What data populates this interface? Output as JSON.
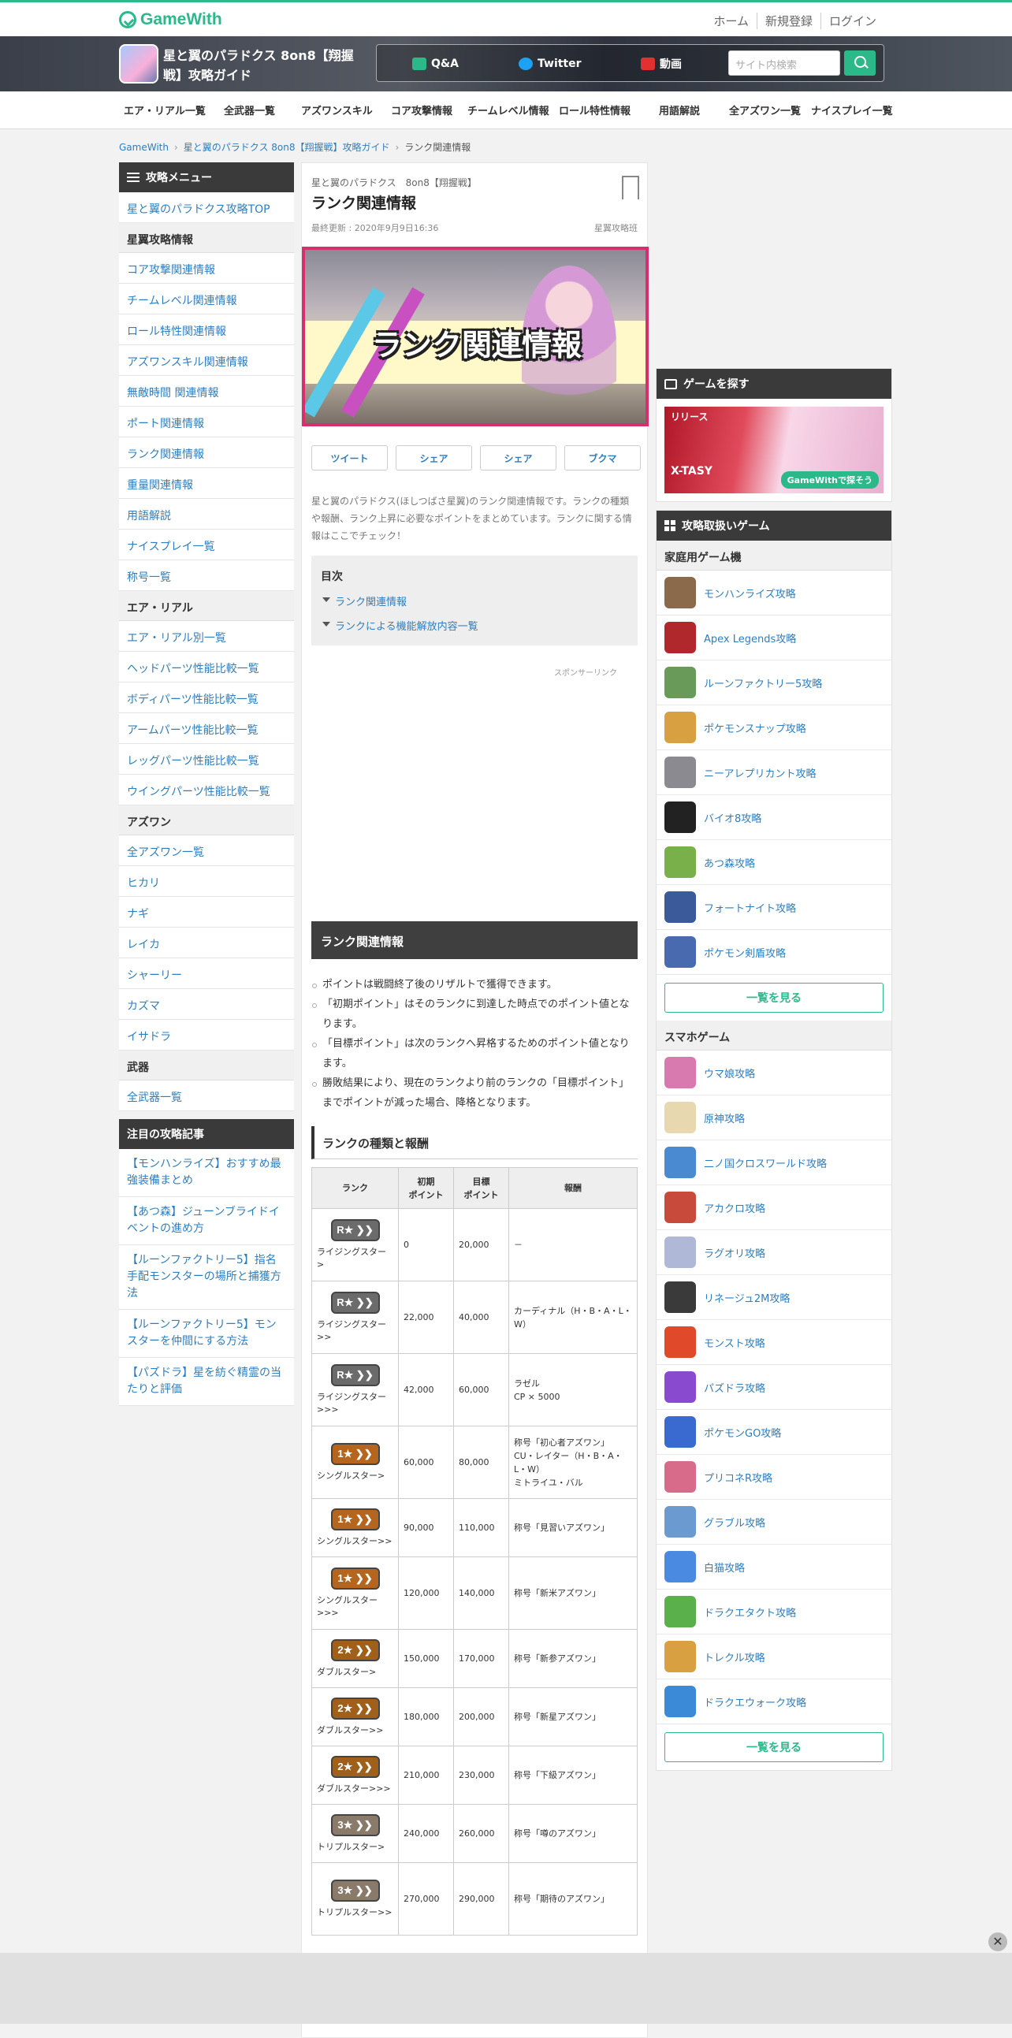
{
  "header": {
    "logo": "GameWith",
    "links": [
      "ホーム",
      "新規登録",
      "ログイン"
    ]
  },
  "gamebar": {
    "title": "星と翼のパラドクス 8on8【翔握戦】攻略ガイド",
    "buttons": [
      "Q&A",
      "Twitter",
      "動画"
    ],
    "search_placeholder": "サイト内検索"
  },
  "nav": [
    "エア・リアル一覧",
    "全武器一覧",
    "アズワンスキル",
    "コア攻撃情報",
    "チームレベル情報",
    "ロール特性情報",
    "用語解説",
    "全アズワン一覧",
    "ナイスプレイ一覧"
  ],
  "breadcrumb": [
    "GameWith",
    "星と翼のパラドクス 8on8【翔握戦】攻略ガイド",
    "ランク関連情報"
  ],
  "left_menu": {
    "title": "攻略メニュー",
    "top_link": "星と翼のパラドクス攻略TOP",
    "sections": [
      {
        "name": "星翼攻略情報",
        "items": [
          "コア攻撃関連情報",
          "チームレベル関連情報",
          "ロール特性関連情報",
          "アズワンスキル関連情報",
          "無敵時間 関連情報",
          "ポート関連情報",
          "ランク関連情報",
          "重量関連情報",
          "用語解説",
          "ナイスプレイ一覧",
          "称号一覧"
        ]
      },
      {
        "name": "エア・リアル",
        "items": [
          "エア・リアル別一覧",
          "ヘッドパーツ性能比較一覧",
          "ボディパーツ性能比較一覧",
          "アームパーツ性能比較一覧",
          "レッグパーツ性能比較一覧",
          "ウイングパーツ性能比較一覧"
        ]
      },
      {
        "name": "アズワン",
        "items": [
          "全アズワン一覧",
          "ヒカリ",
          "ナギ",
          "レイカ",
          "シャーリー",
          "カズマ",
          "イサドラ"
        ]
      },
      {
        "name": "武器",
        "items": [
          "全武器一覧"
        ]
      }
    ]
  },
  "notice": {
    "title": "注目の攻略記事",
    "items": [
      "【モンハンライズ】おすすめ最強装備まとめ",
      "【あつ森】ジューンブライドイベントの進め方",
      "【ルーンファクトリー5】指名手配モンスターの場所と捕獲方法",
      "【ルーンファクトリー5】モンスターを仲間にする方法",
      "【パズドラ】星を紡ぐ精霊の当たりと評価"
    ]
  },
  "article": {
    "subtitle": "星と翼のパラドクス　8on8【翔握戦】",
    "title": "ランク関連情報",
    "updated": "最終更新 : 2020年9月9日16:36",
    "author": "星翼攻略班",
    "banner_text": "ランク関連情報",
    "share": [
      "ツイート",
      "シェア",
      "シェア",
      "ブクマ"
    ],
    "intro": "星と翼のパラドクス(ほしつばさ星翼)のランク関連情報です。ランクの種類や報酬、ランク上昇に必要なポイントをまとめています。ランクに関する情報はここでチェック！",
    "toc_title": "目次",
    "toc": [
      "ランク関連情報",
      "ランクによる機能解放内容一覧"
    ],
    "sponsor": "スポンサーリンク",
    "section_title": "ランク関連情報",
    "bullets": [
      "ポイントは戦闘終了後のリザルトで獲得できます。",
      "「初期ポイント」はそのランクに到達した時点でのポイント値となります。",
      "「目標ポイント」は次のランクへ昇格するためのポイント値となります。",
      "勝敗結果により、現在のランクより前のランクの「目標ポイント」までポイントが減った場合、降格となります。"
    ],
    "table_title": "ランクの種類と報酬",
    "table_headers": [
      "ランク",
      "初期\nポイント",
      "目標\nポイント",
      "報酬"
    ],
    "rows": [
      {
        "badge": "R",
        "color": "#6b6b6b",
        "name": "ライジングスター>",
        "init": "0",
        "goal": "20,000",
        "reward": "－"
      },
      {
        "badge": "R",
        "color": "#6b6b6b",
        "name": "ライジングスター>>",
        "init": "22,000",
        "goal": "40,000",
        "reward": "カーディナル（H・B・A・L・W）"
      },
      {
        "badge": "R",
        "color": "#6b6b6b",
        "name": "ライジングスター>>>",
        "init": "42,000",
        "goal": "60,000",
        "reward": "ラゼル\nCP × 5000"
      },
      {
        "badge": "1",
        "color": "#b5651d",
        "name": "シングルスター>",
        "init": "60,000",
        "goal": "80,000",
        "reward": "称号「初心者アズワン」\nCU・レイター（H・B・A・L・W）\nミトライユ・バル"
      },
      {
        "badge": "1",
        "color": "#b5651d",
        "name": "シングルスター>>",
        "init": "90,000",
        "goal": "110,000",
        "reward": "称号「見習いアズワン」"
      },
      {
        "badge": "1",
        "color": "#b5651d",
        "name": "シングルスター>>>",
        "init": "120,000",
        "goal": "140,000",
        "reward": "称号「新米アズワン」"
      },
      {
        "badge": "2",
        "color": "#a0601a",
        "name": "ダブルスター>",
        "init": "150,000",
        "goal": "170,000",
        "reward": "称号「新参アズワン」"
      },
      {
        "badge": "2",
        "color": "#a0601a",
        "name": "ダブルスター>>",
        "init": "180,000",
        "goal": "200,000",
        "reward": "称号「新星アズワン」"
      },
      {
        "badge": "2",
        "color": "#a0601a",
        "name": "ダブルスター>>>",
        "init": "210,000",
        "goal": "230,000",
        "reward": "称号「下級アズワン」"
      },
      {
        "badge": "3",
        "color": "#8a7a6a",
        "name": "トリプルスター>",
        "init": "240,000",
        "goal": "260,000",
        "reward": "称号「噂のアズワン」"
      },
      {
        "badge": "3",
        "color": "#8a7a6a",
        "name": "トリプルスター>>",
        "init": "270,000",
        "goal": "290,000",
        "reward": "称号「期待のアズワン」"
      }
    ]
  },
  "right": {
    "find_title": "ゲームを探す",
    "promo_top": "リリース",
    "promo_main": "X-TASY",
    "promo_tag": "GameWithで探そう",
    "handled_title": "攻略取扱いゲーム",
    "console_cat": "家庭用ゲーム機",
    "console": [
      {
        "name": "モンハンライズ攻略",
        "c": "#8a6a4a"
      },
      {
        "name": "Apex Legends攻略",
        "c": "#b0282c"
      },
      {
        "name": "ルーンファクトリー5攻略",
        "c": "#6a9a5a"
      },
      {
        "name": "ポケモンスナップ攻略",
        "c": "#d8a040"
      },
      {
        "name": "ニーアレプリカント攻略",
        "c": "#8a8a90"
      },
      {
        "name": "バイオ8攻略",
        "c": "#222222"
      },
      {
        "name": "あつ森攻略",
        "c": "#7ab04a"
      },
      {
        "name": "フォートナイト攻略",
        "c": "#3a5a9a"
      },
      {
        "name": "ポケモン剣盾攻略",
        "c": "#4a6ab0"
      }
    ],
    "more": "一覧を見る",
    "phone_cat": "スマホゲーム",
    "phone": [
      {
        "name": "ウマ娘攻略",
        "c": "#d87ab0"
      },
      {
        "name": "原神攻略",
        "c": "#e8d8b0"
      },
      {
        "name": "二ノ国クロスワールド攻略",
        "c": "#4a8ad0"
      },
      {
        "name": "アカクロ攻略",
        "c": "#c84a3a"
      },
      {
        "name": "ラグオリ攻略",
        "c": "#b0b8d8"
      },
      {
        "name": "リネージュ2M攻略",
        "c": "#3a3a3a"
      },
      {
        "name": "モンスト攻略",
        "c": "#e04a2a"
      },
      {
        "name": "パズドラ攻略",
        "c": "#8a4ad0"
      },
      {
        "name": "ポケモンGO攻略",
        "c": "#3a6ad0"
      },
      {
        "name": "プリコネR攻略",
        "c": "#d86a8a"
      },
      {
        "name": "グラブル攻略",
        "c": "#6a9ad0"
      },
      {
        "name": "白猫攻略",
        "c": "#4a8ae0"
      },
      {
        "name": "ドラクエタクト攻略",
        "c": "#5ab04a"
      },
      {
        "name": "トレクル攻略",
        "c": "#d8a040"
      },
      {
        "name": "ドラクエウォーク攻略",
        "c": "#3a8ad8"
      }
    ]
  }
}
